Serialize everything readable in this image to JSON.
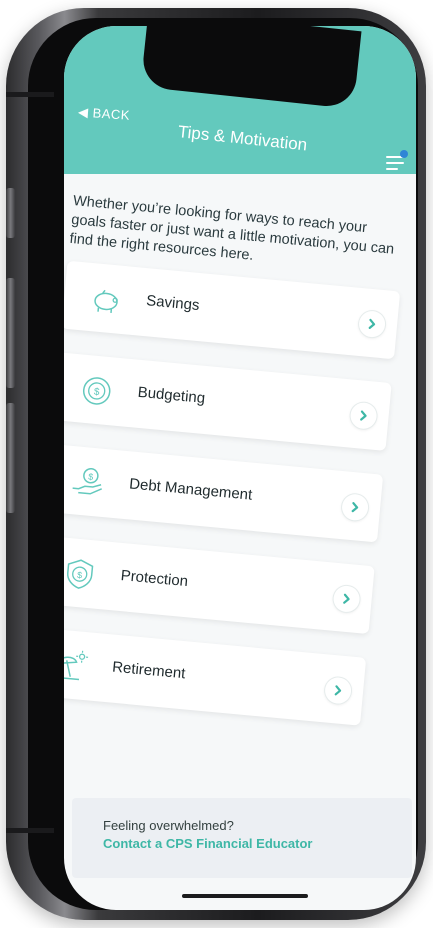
{
  "header": {
    "back_label": "BACK",
    "title": "Tips & Motivation",
    "accent_color": "#63c9bd"
  },
  "intro": "Whether you’re looking for ways to reach your goals faster or just want a little motivation, you can find the right resources here.",
  "categories": [
    {
      "label": "Savings",
      "icon": "piggy-bank-icon"
    },
    {
      "label": "Budgeting",
      "icon": "coin-dollar-icon"
    },
    {
      "label": "Debt Management",
      "icon": "hand-coin-icon"
    },
    {
      "label": "Protection",
      "icon": "shield-dollar-icon"
    },
    {
      "label": "Retirement",
      "icon": "beach-umbrella-icon"
    }
  ],
  "footer": {
    "question": "Feeling overwhelmed?",
    "link": "Contact a CPS Financial Educator",
    "link_color": "#3eb7a6"
  }
}
